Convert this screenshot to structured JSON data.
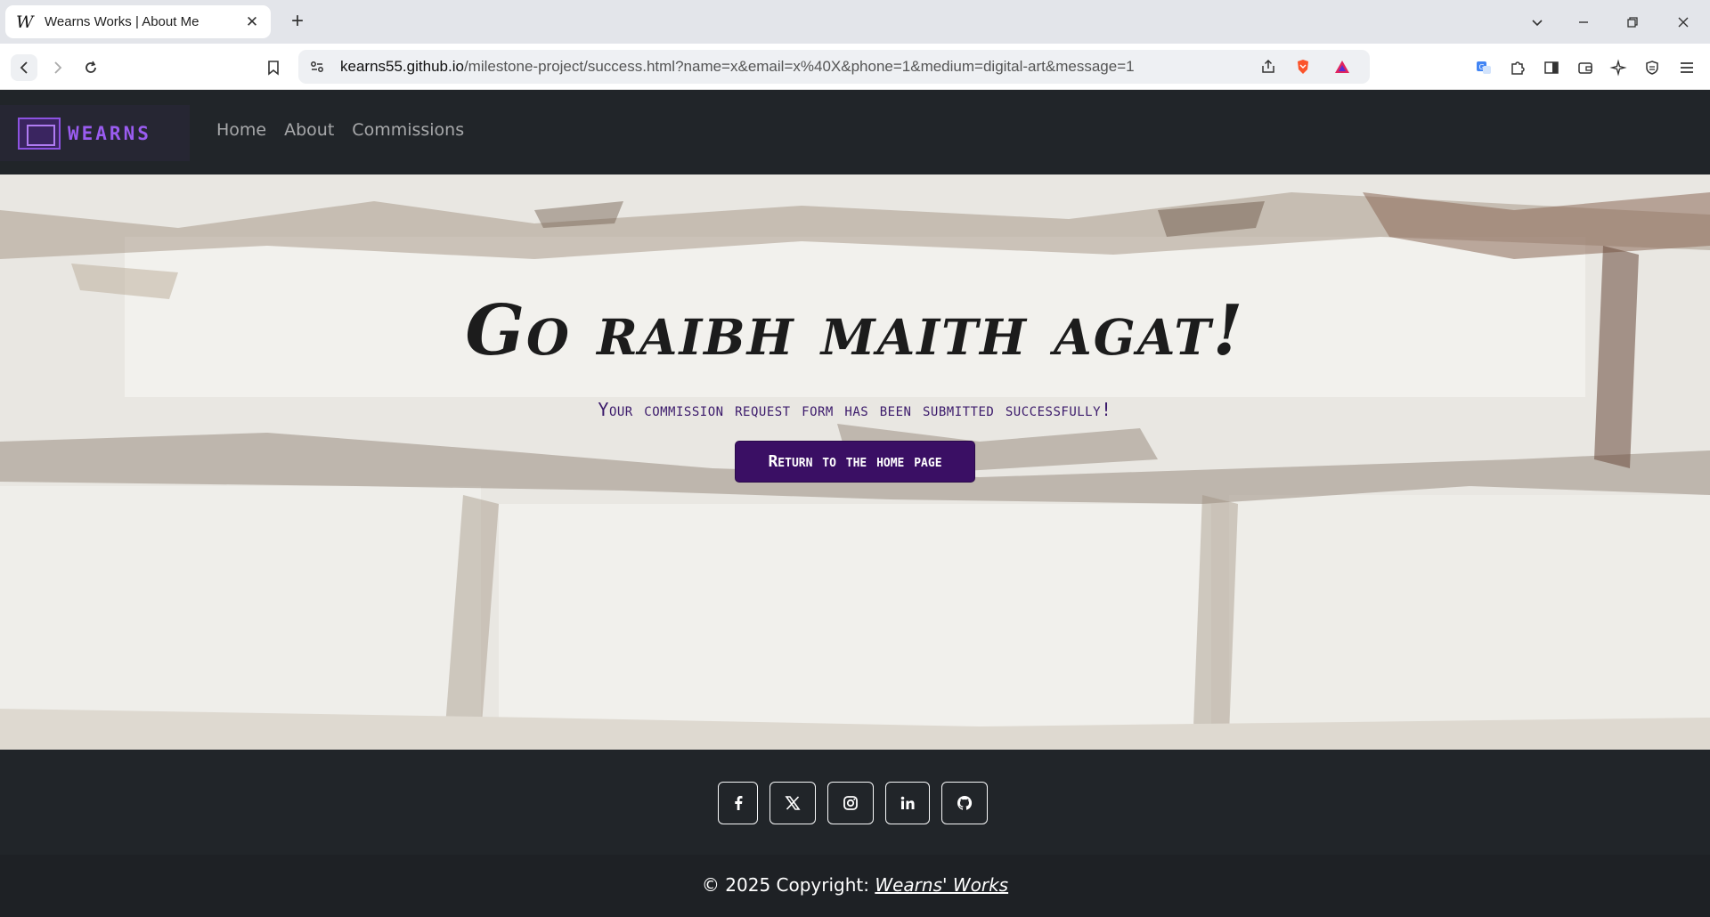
{
  "browser": {
    "tab_favicon": "W",
    "tab_title": "Wearns Works | About Me",
    "tab_close": "✕",
    "new_tab": "+",
    "url_host": "kearns55.github.io",
    "url_path": "/milestone-project/success.html?name=x&email=x%40X&phone=1&medium=digital-art&message=1"
  },
  "navbar": {
    "brand": "WEARNS",
    "links": [
      "Home",
      "About",
      "Commissions"
    ]
  },
  "hero": {
    "title": "Go raibh maith agat!",
    "subtitle": "Your commission request form has been submitted successfully!",
    "button": "Return to the home page"
  },
  "footer": {
    "social": [
      "facebook-icon",
      "x-twitter-icon",
      "instagram-icon",
      "linkedin-icon",
      "github-icon"
    ],
    "copyright_prefix": "© 2025 Copyright: ",
    "copyright_link": "Wearns' Works"
  },
  "colors": {
    "navbar_bg": "#212529",
    "accent_purple": "#3a0f64",
    "brand_purple": "#9a5cf0",
    "subtitle_purple": "#3b1a6b"
  }
}
